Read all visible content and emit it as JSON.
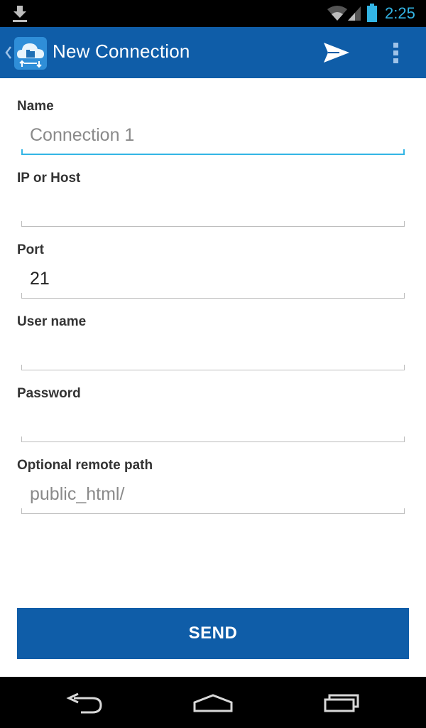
{
  "status_bar": {
    "time": "2:25",
    "icons": [
      "download-icon",
      "wifi-icon",
      "signal-icon",
      "battery-icon"
    ],
    "accent_color": "#33b5e5"
  },
  "action_bar": {
    "title": "New Connection",
    "icons": [
      "up-caret-icon",
      "app-cloud-icon",
      "send-icon",
      "overflow-menu-icon"
    ],
    "background_color": "#0f5da8"
  },
  "form": {
    "name": {
      "label": "Name",
      "value": "",
      "placeholder": "Connection 1"
    },
    "host": {
      "label": "IP or Host",
      "value": "",
      "placeholder": ""
    },
    "port": {
      "label": "Port",
      "value": "21",
      "placeholder": ""
    },
    "username": {
      "label": "User name",
      "value": "",
      "placeholder": ""
    },
    "password": {
      "label": "Password",
      "value": "",
      "placeholder": ""
    },
    "remote_path": {
      "label": "Optional remote path",
      "value": "",
      "placeholder": "public_html/"
    }
  },
  "send_button": {
    "label": "SEND"
  },
  "nav_bar": {
    "icons": [
      "back-icon",
      "home-icon",
      "recents-icon"
    ]
  }
}
